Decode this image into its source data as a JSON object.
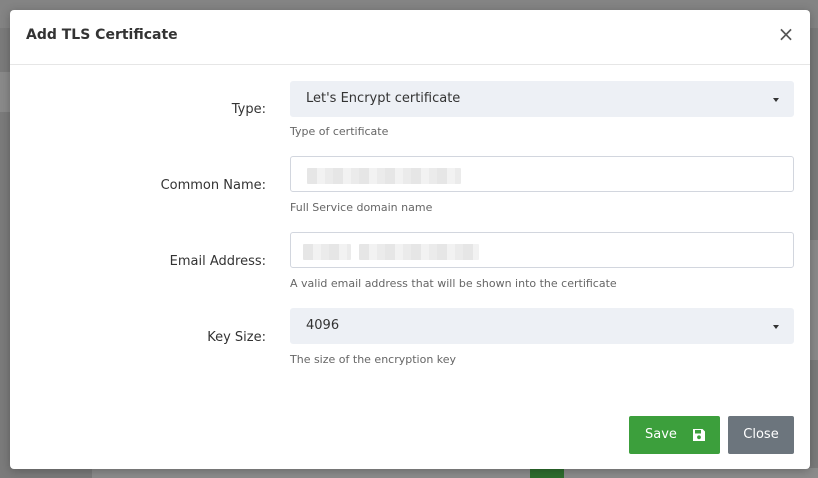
{
  "modal": {
    "title": "Add TLS Certificate",
    "close_symbol": "×"
  },
  "form": {
    "type": {
      "label": "Type:",
      "selected": "Let's Encrypt certificate",
      "help": "Type of certificate"
    },
    "common_name": {
      "label": "Common Name:",
      "value": "",
      "help": "Full Service domain name"
    },
    "email": {
      "label": "Email Address:",
      "value": "",
      "help": "A valid email address that will be shown into the certificate"
    },
    "key_size": {
      "label": "Key Size:",
      "selected": "4096",
      "help": "The size of the encryption key"
    }
  },
  "footer": {
    "save_label": "Save",
    "close_label": "Close"
  },
  "colors": {
    "save_button": "#3c9f3c",
    "close_button": "#6c757d",
    "select_background": "#edf0f5"
  },
  "icons": {
    "save": "floppy-disk-icon",
    "dropdown": "caret-down-icon",
    "close": "close-icon"
  }
}
